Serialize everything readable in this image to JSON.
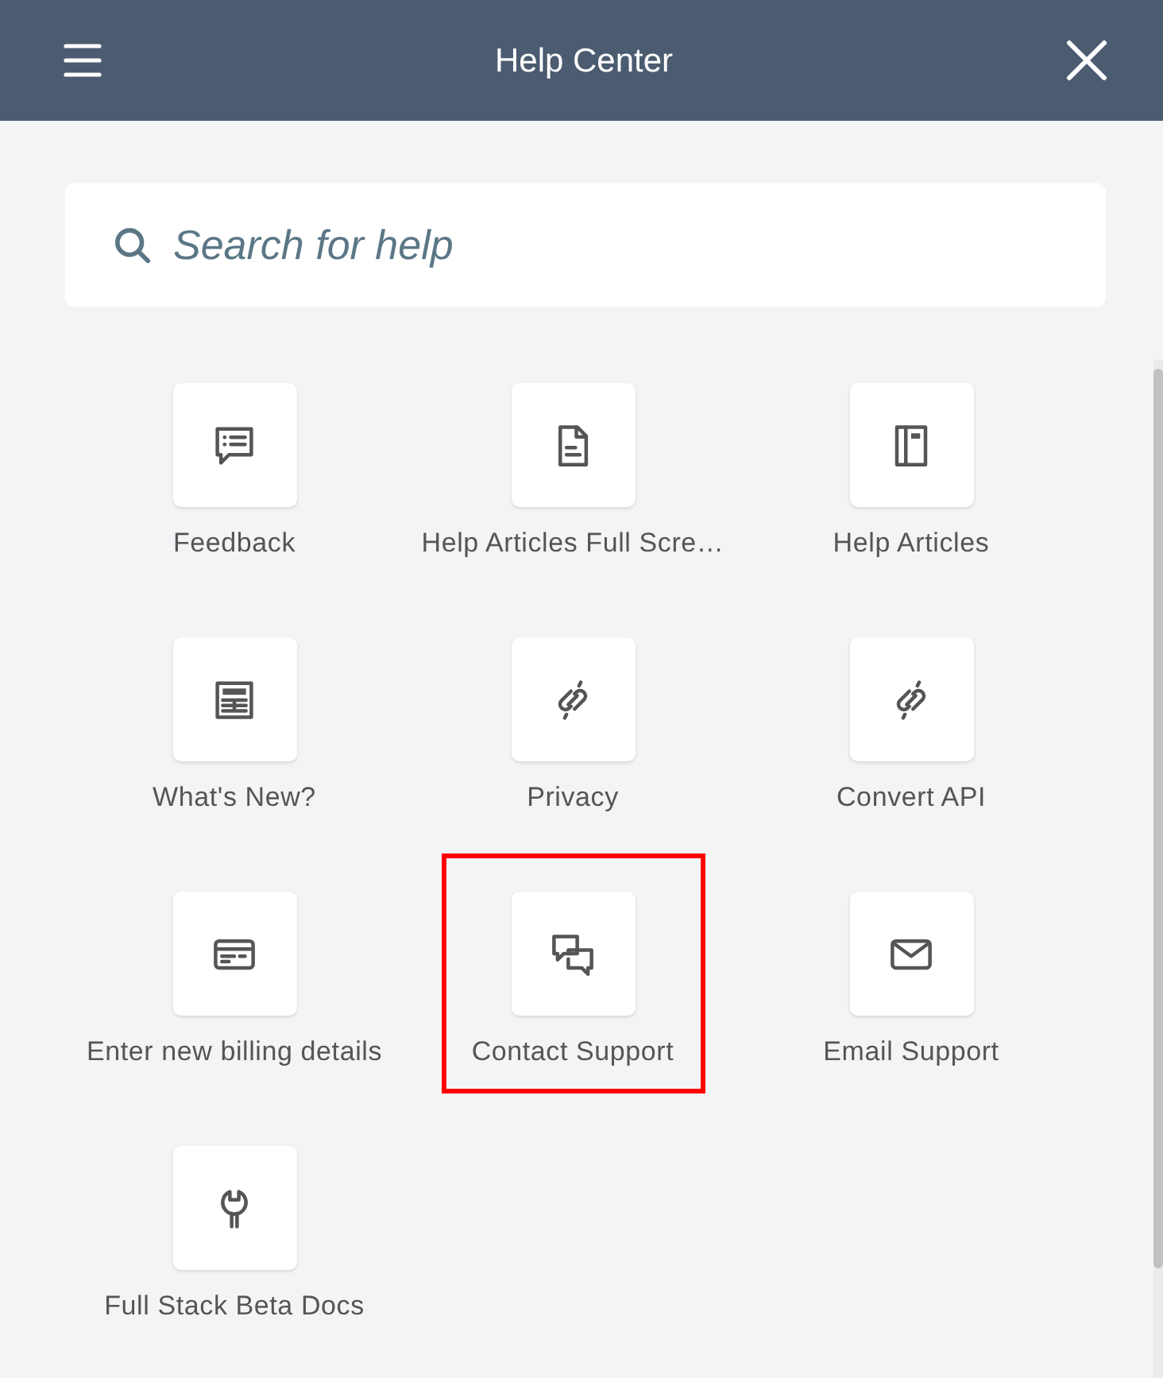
{
  "header": {
    "title": "Help Center"
  },
  "search": {
    "placeholder": "Search for help"
  },
  "items": [
    {
      "label": "Feedback",
      "kind": "feedback",
      "highlighted": false
    },
    {
      "label": "Help Articles Full Scre…",
      "kind": "article",
      "highlighted": false
    },
    {
      "label": "Help Articles",
      "kind": "notebook",
      "highlighted": false
    },
    {
      "label": "What's New?",
      "kind": "newsletter",
      "highlighted": false
    },
    {
      "label": "Privacy",
      "kind": "link",
      "highlighted": false
    },
    {
      "label": "Convert API",
      "kind": "link",
      "highlighted": false
    },
    {
      "label": "Enter new billing details",
      "kind": "card",
      "highlighted": false
    },
    {
      "label": "Contact Support",
      "kind": "chat",
      "highlighted": true
    },
    {
      "label": "Email Support",
      "kind": "mail",
      "highlighted": false
    },
    {
      "label": "Full Stack Beta Docs",
      "kind": "wrench",
      "highlighted": false
    }
  ]
}
